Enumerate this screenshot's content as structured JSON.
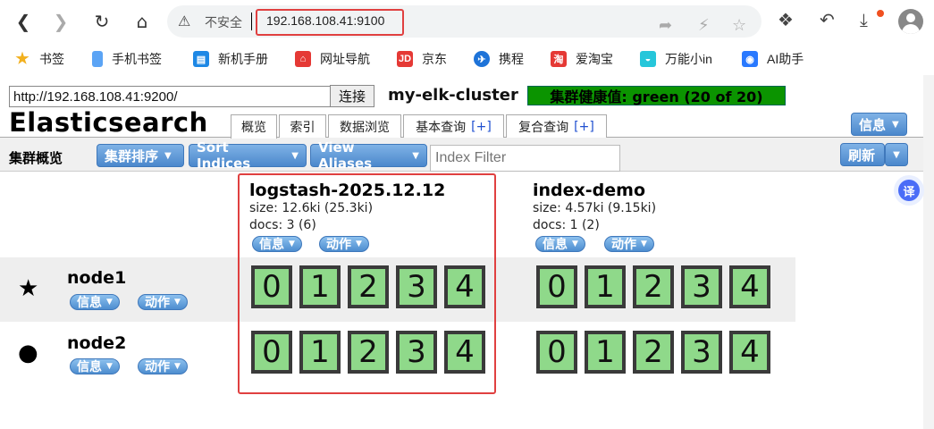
{
  "browser": {
    "back_icon": "arrow-left-icon",
    "forward_icon": "arrow-right-icon",
    "insecure_label": "不安全",
    "url": "192.168.108.41:9100"
  },
  "bookmarks": [
    {
      "label": "书签",
      "icon": "star-icon",
      "color": "#f2b01e"
    },
    {
      "label": "手机书签",
      "icon": "phone-icon",
      "color": "#5ba4f5"
    },
    {
      "label": "新机手册",
      "icon": "book-icon",
      "color": "#1e88e5"
    },
    {
      "label": "网址导航",
      "icon": "nav-icon",
      "color": "#e53935"
    },
    {
      "label": "京东",
      "icon": "jd-icon",
      "color": "#e53935"
    },
    {
      "label": "携程",
      "icon": "ctrip-icon",
      "color": "#1e73d8"
    },
    {
      "label": "爱淘宝",
      "icon": "taobao-icon",
      "color": "#e53935"
    },
    {
      "label": "万能小in",
      "icon": "robot-icon",
      "color": "#26c6da"
    },
    {
      "label": "AI助手",
      "icon": "ai-icon",
      "color": "#2979ff"
    }
  ],
  "es": {
    "connect_url": "http://192.168.108.41:9200/",
    "connect_button": "连接",
    "cluster_name": "my-elk-cluster",
    "health": "集群健康值: green (20 of 20)",
    "health_color": "#0b9400",
    "title": "Elasticsearch",
    "tabs": [
      {
        "label": "概览",
        "plus": ""
      },
      {
        "label": "索引",
        "plus": ""
      },
      {
        "label": "数据浏览",
        "plus": ""
      },
      {
        "label": "基本查询",
        "plus": "[+]"
      },
      {
        "label": "复合查询",
        "plus": "[+]"
      }
    ],
    "info_button": "信息",
    "overview_label": "集群概览",
    "sort_cluster": "集群排序",
    "sort_indices": "Sort Indices",
    "view_aliases": "View Aliases",
    "filter_placeholder": "Index Filter",
    "refresh": "刷新",
    "info_label": "信息",
    "action_label": "动作"
  },
  "indices": [
    {
      "name": "logstash-2025.12.12",
      "size": "size: 12.6ki (25.3ki)",
      "docs": "docs: 3 (6)",
      "shards": [
        "0",
        "1",
        "2",
        "3",
        "4"
      ]
    },
    {
      "name": "index-demo",
      "size": "size: 4.57ki (9.15ki)",
      "docs": "docs: 1 (2)",
      "shards": [
        "0",
        "1",
        "2",
        "3",
        "4"
      ]
    }
  ],
  "nodes": [
    {
      "name": "node1",
      "icon": "star-icon",
      "glyph": "★"
    },
    {
      "name": "node2",
      "icon": "circle-icon",
      "glyph": "●"
    }
  ],
  "translate_label": "译"
}
